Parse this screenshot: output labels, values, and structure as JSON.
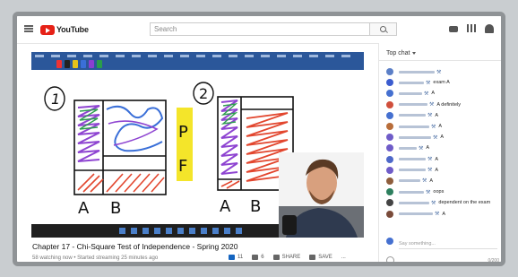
{
  "header": {
    "logo_text": "YouTube",
    "search_placeholder": "Search"
  },
  "video": {
    "title": "Chapter 17 - Chi-Square Test of Independence - Spring 2020",
    "meta": "58 watching now • Started streaming 25 minutes ago",
    "board_labels": {
      "num1": "1",
      "num2": "2",
      "p": "P",
      "f": "F",
      "a1": "A",
      "b1": "B",
      "a2": "A",
      "b2": "B"
    },
    "actions": {
      "likes": "11",
      "dislikes": "6",
      "share": "SHARE",
      "save": "SAVE",
      "more": "..."
    }
  },
  "chat": {
    "header": "Top chat",
    "messages": [
      {
        "text": "",
        "avatar": "#5b7fc7"
      },
      {
        "text": "exam A",
        "avatar": "#3b5ccf"
      },
      {
        "text": "A",
        "avatar": "#4570d0"
      },
      {
        "text": "A definitely",
        "avatar": "#d04f3c"
      },
      {
        "text": "A",
        "avatar": "#4570d0"
      },
      {
        "text": "A",
        "avatar": "#b86d3a"
      },
      {
        "text": "A",
        "avatar": "#6f5cc8"
      },
      {
        "text": "A",
        "avatar": "#6f5cc8"
      },
      {
        "text": "A",
        "avatar": "#4e68c9"
      },
      {
        "text": "A",
        "avatar": "#6f5cc8"
      },
      {
        "text": "A",
        "avatar": "#8e5d3c"
      },
      {
        "text": "oops",
        "avatar": "#2d7f5e"
      },
      {
        "text": "dependent on the exam",
        "avatar": "#444"
      },
      {
        "text": "A",
        "avatar": "#7a4b3a"
      }
    ],
    "input_placeholder": "Say something...",
    "char_count": "0/200"
  }
}
